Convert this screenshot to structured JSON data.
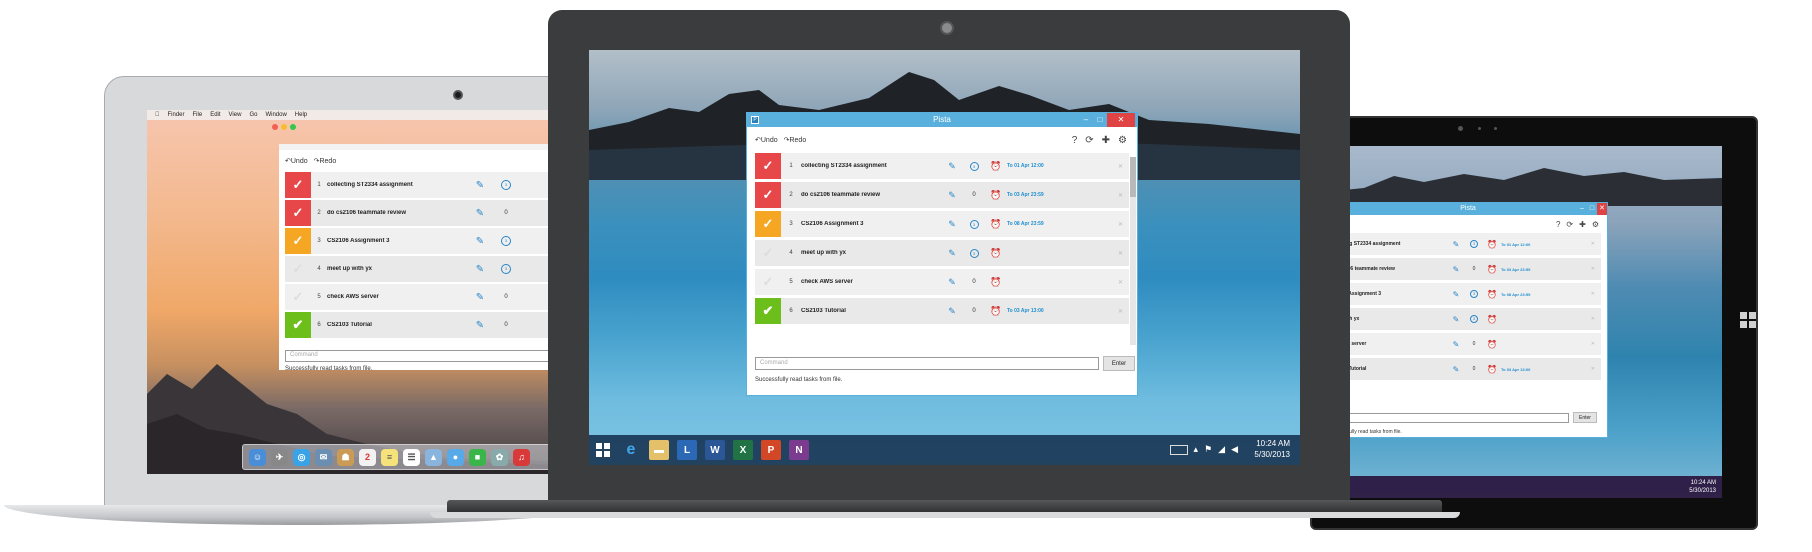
{
  "app": {
    "title": "Pista",
    "undo_label": "Undo",
    "redo_label": "Redo",
    "command_placeholder": "Command",
    "enter_label": "Enter",
    "status": "Successfully read tasks from file.",
    "tasks": [
      {
        "num": "1",
        "name": "collecting ST2334 assignment",
        "count": "",
        "due": "To 01 Apr 12:00",
        "color": "#e8474a",
        "done": false,
        "has_repeat": true,
        "has_alarm": true
      },
      {
        "num": "2",
        "name": "do cs2106 teammate review",
        "count": "0",
        "due": "To 03 Apr 23:59",
        "color": "#e8474a",
        "done": false,
        "has_repeat": false,
        "has_alarm": true
      },
      {
        "num": "3",
        "name": "CS2106 Assignment 3",
        "count": "",
        "due": "To 08 Apr 23:59",
        "color": "#f5a623",
        "done": false,
        "has_repeat": true,
        "has_alarm": true
      },
      {
        "num": "4",
        "name": "meet up with yx",
        "count": "",
        "due": "",
        "color": "#eeeeee",
        "done": false,
        "has_repeat": true,
        "has_alarm": true
      },
      {
        "num": "5",
        "name": "check AWS server",
        "count": "0",
        "due": "",
        "color": "#eeeeee",
        "done": false,
        "has_repeat": false,
        "has_alarm": true
      },
      {
        "num": "6",
        "name": "CS2103 Tutorial",
        "count": "0",
        "due": "To 03 Apr 13:00",
        "color": "#6cbf1a",
        "done": true,
        "has_repeat": false,
        "has_alarm": true
      }
    ]
  },
  "mac": {
    "menubar": [
      "Finder",
      "File",
      "Edit",
      "View",
      "Go",
      "Window",
      "Help"
    ]
  },
  "tablet": {
    "tasks_visible_names": [
      "collecting ST2334 assignment",
      "do cs2106 teammate review",
      "CS2106 Assignment 3",
      "et up with yx",
      "eck AWS server",
      "CS2103 Tutorial"
    ],
    "clock_time": "10:24 AM",
    "clock_date": "5/30/2013"
  },
  "laptop": {
    "clock_time": "10:24 AM",
    "clock_date": "5/30/2013"
  },
  "colors": {
    "titlebar": "#5ab0dc",
    "accent": "#1f8fd0",
    "close": "#e04343"
  },
  "icons": [
    "apple-icon",
    "undo-icon",
    "redo-icon",
    "help-icon",
    "sync-icon",
    "add-icon",
    "settings-icon",
    "checkmark-icon",
    "pencil-icon",
    "repeat-icon",
    "alarm-icon",
    "close-icon",
    "windows-start-icon",
    "ie-icon",
    "folder-icon",
    "lync-icon",
    "word-icon",
    "excel-icon",
    "powerpoint-icon",
    "onenote-icon",
    "keyboard-icon"
  ]
}
